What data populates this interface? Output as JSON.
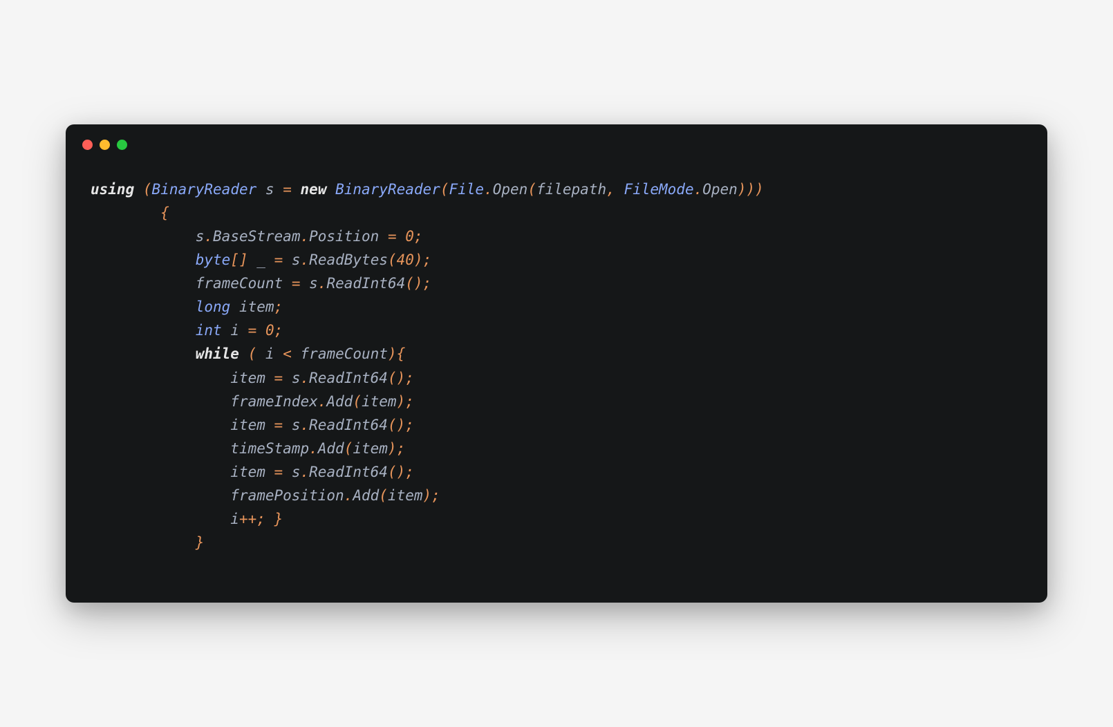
{
  "window": {
    "dots": {
      "red": "#ff5f57",
      "yellow": "#febc2e",
      "green": "#28c840"
    }
  },
  "code": {
    "t": {
      "using": "using",
      "new": "new",
      "byte": "byte",
      "long": "long",
      "int": "int",
      "while": "while",
      "BinaryReader": "BinaryReader",
      "File": "File",
      "Open": "Open",
      "filepath": "filepath",
      "FileMode": "FileMode",
      "s": "s",
      "BaseStream": "BaseStream",
      "Position": "Position",
      "ReadBytes": "ReadBytes",
      "ReadInt64": "ReadInt64",
      "frameCount": "frameCount",
      "item": "item",
      "i": "i",
      "frameIndex": "frameIndex",
      "timeStamp": "timeStamp",
      "framePosition": "framePosition",
      "Add": "Add",
      "underscore": "_",
      "eq": "=",
      "lt": "<",
      "pp": "++",
      "n0": "0",
      "n40": "40",
      "lp": "(",
      "rp": ")",
      "lcb": "{",
      "rcb": "}",
      "lsb": "[",
      "rsb": "]",
      "comma": ",",
      "dot": ".",
      "semi": ";",
      "sp": " "
    },
    "indent1": "        ",
    "indent2": "            ",
    "indent3": "                "
  }
}
